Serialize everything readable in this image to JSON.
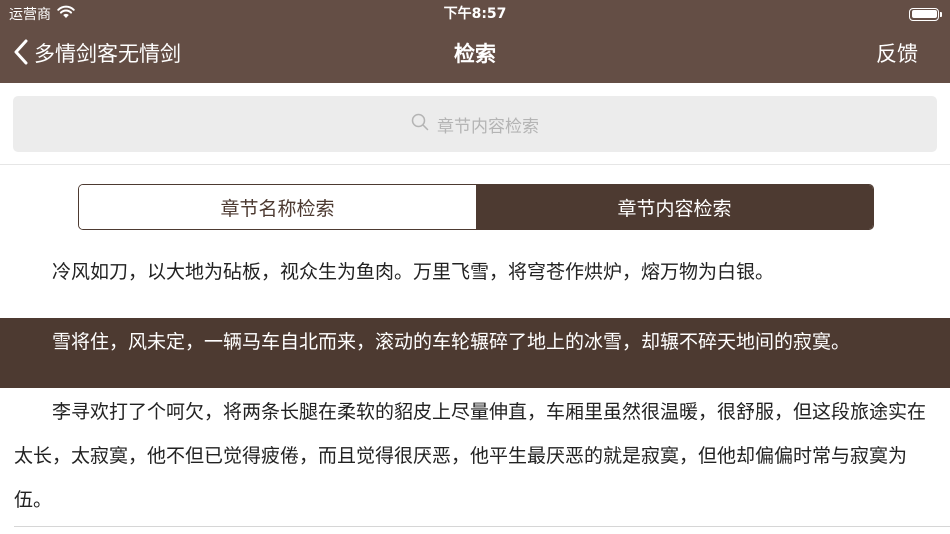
{
  "status_bar": {
    "carrier": "运营商",
    "time": "下午8:57"
  },
  "nav": {
    "back_label": "多情剑客无情剑",
    "title": "检索",
    "feedback_label": "反馈"
  },
  "search": {
    "placeholder": "章节内容检索"
  },
  "segments": [
    {
      "label": "章节名称检索",
      "selected": false
    },
    {
      "label": "章节内容检索",
      "selected": true
    }
  ],
  "results": [
    {
      "text": "冷风如刀，以大地为砧板，视众生为鱼肉。万里飞雪，将穹苍作烘炉，熔万物为白银。",
      "highlighted": false
    },
    {
      "text": "雪将住，风未定，一辆马车自北而来，滚动的车轮辗碎了地上的冰雪，却辗不碎天地间的寂寞。",
      "highlighted": true
    },
    {
      "text": "李寻欢打了个呵欠，将两条长腿在柔软的貂皮上尽量伸直，车厢里虽然很温暖，很舒服，但这段旅途实在太长，太寂寞，他不但已觉得疲倦，而且觉得很厌恶，他平生最厌恶的就是寂寞，但他却偏偏时常与寂寞为伍。",
      "highlighted": false
    }
  ],
  "colors": {
    "nav_bar": "#644e45",
    "accent_dark": "#4d3a31",
    "search_bg": "#ececec",
    "placeholder": "#b4b4b4"
  },
  "icons": {
    "wifi": "wifi-icon",
    "battery": "battery-icon",
    "back": "chevron-left-icon",
    "search": "search-icon"
  }
}
